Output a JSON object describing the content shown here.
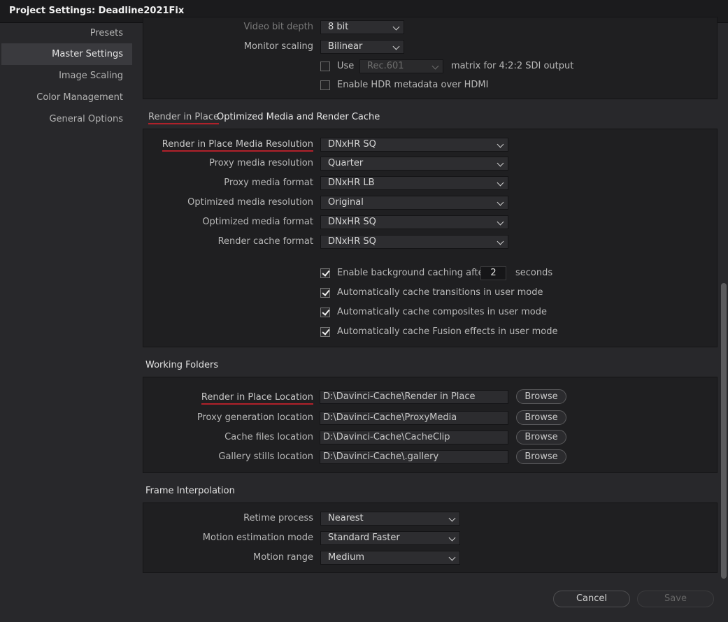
{
  "window": {
    "title": "Project Settings:  Deadline2021Fix"
  },
  "sidebar": {
    "items": [
      {
        "label": "Presets"
      },
      {
        "label": "Master Settings"
      },
      {
        "label": "Image Scaling"
      },
      {
        "label": "Color Management"
      },
      {
        "label": "General Options"
      }
    ],
    "active": "Master Settings"
  },
  "video_panel": {
    "bit_depth": {
      "label": "Video bit depth",
      "value": "8 bit"
    },
    "monitor_scaling": {
      "label": "Monitor scaling",
      "value": "Bilinear"
    },
    "use_matrix": {
      "checkbox_label": "Use",
      "value": "Rec.601",
      "suffix": "matrix for 4:2:2 SDI output",
      "checked": false
    },
    "hdr_metadata": {
      "label": "Enable HDR metadata over HDMI",
      "checked": false
    }
  },
  "render_section": {
    "title_underlined": "Render in Place",
    "title_rest": "Optimized Media and Render Cache",
    "fields": [
      {
        "label": "Render in Place Media Resolution",
        "value": "DNxHR SQ"
      },
      {
        "label": "Proxy media resolution",
        "value": "Quarter"
      },
      {
        "label": "Proxy media format",
        "value": "DNxHR LB"
      },
      {
        "label": "Optimized media resolution",
        "value": "Original"
      },
      {
        "label": "Optimized media format",
        "value": "DNxHR SQ"
      },
      {
        "label": "Render cache format",
        "value": "DNxHR SQ"
      }
    ],
    "bg_caching": {
      "label": "Enable background caching after",
      "value": "2",
      "unit": "seconds",
      "checked": true
    },
    "checks": [
      {
        "label": "Automatically cache transitions in user mode",
        "checked": true
      },
      {
        "label": "Automatically cache composites in user mode",
        "checked": true
      },
      {
        "label": "Automatically cache Fusion effects in user mode",
        "checked": true
      }
    ]
  },
  "working_folders": {
    "title": "Working Folders",
    "rows": [
      {
        "label": "Render in Place Location",
        "path": "D:\\Davinci-Cache\\Render in Place",
        "button": "Browse"
      },
      {
        "label": "Proxy generation location",
        "path": "D:\\Davinci-Cache\\ProxyMedia",
        "button": "Browse"
      },
      {
        "label": "Cache files location",
        "path": "D:\\Davinci-Cache\\CacheClip",
        "button": "Browse"
      },
      {
        "label": "Gallery stills location",
        "path": "D:\\Davinci-Cache\\.gallery",
        "button": "Browse"
      }
    ]
  },
  "frame_interpolation": {
    "title": "Frame Interpolation",
    "fields": [
      {
        "label": "Retime process",
        "value": "Nearest"
      },
      {
        "label": "Motion estimation mode",
        "value": "Standard Faster"
      },
      {
        "label": "Motion range",
        "value": "Medium"
      }
    ]
  },
  "footer": {
    "cancel": "Cancel",
    "save": "Save"
  }
}
